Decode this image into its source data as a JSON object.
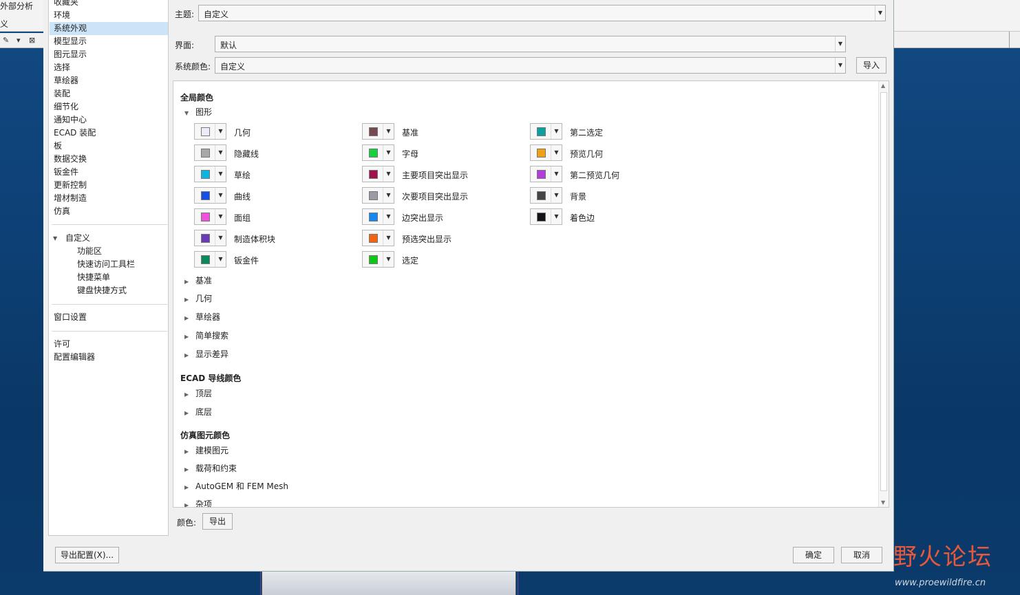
{
  "app": {
    "topbar_line1": "外部分析",
    "topbar_line2": "义"
  },
  "nav": {
    "items": [
      "收藏夹",
      "环境",
      "系统外观",
      "模型显示",
      "图元显示",
      "选择",
      "草绘器",
      "装配",
      "细节化",
      "通知中心",
      "ECAD 装配",
      "板",
      "数据交换",
      "钣金件",
      "更新控制",
      "增材制造",
      "仿真"
    ],
    "selected": "系统外观",
    "customize": "自定义",
    "customize_children": [
      "功能区",
      "快速访问工具栏",
      "快捷菜单",
      "键盘快捷方式"
    ],
    "window_settings": "窗口设置",
    "license": "许可",
    "config_editor": "配置编辑器"
  },
  "form": {
    "theme_label": "主题:",
    "theme_value": "自定义",
    "ui_label": "界面:",
    "ui_value": "默认",
    "syscolor_label": "系统颜色:",
    "syscolor_value": "自定义",
    "import_btn": "导入"
  },
  "panel": {
    "global_colors": "全局颜色",
    "graphics": "图形",
    "collapsed_global": [
      "基准",
      "几何",
      "草绘器",
      "简单搜索",
      "显示差异"
    ],
    "ecad_title": "ECAD 导线颜色",
    "ecad_items": [
      "顶层",
      "底层"
    ],
    "sim_title": "仿真图元颜色",
    "sim_items": [
      "建模图元",
      "载荷和约束",
      "AutoGEM 和 FEM Mesh",
      "杂项"
    ]
  },
  "swatches": {
    "col1": [
      {
        "label": "几何",
        "color": "#ecebf7"
      },
      {
        "label": "隐藏线",
        "color": "#a8a8a8"
      },
      {
        "label": "草绘",
        "color": "#0cb4e0"
      },
      {
        "label": "曲线",
        "color": "#1450e6"
      },
      {
        "label": "面组",
        "color": "#f050dc"
      },
      {
        "label": "制造体积块",
        "color": "#6a3cb4"
      },
      {
        "label": "钣金件",
        "color": "#0a8a5a"
      }
    ],
    "col2": [
      {
        "label": "基准",
        "color": "#784850"
      },
      {
        "label": "字母",
        "color": "#14d23c"
      },
      {
        "label": "主要项目突出显示",
        "color": "#a0104c"
      },
      {
        "label": "次要项目突出显示",
        "color": "#9a9ca4"
      },
      {
        "label": "边突出显示",
        "color": "#1488f0"
      },
      {
        "label": "预选突出显示",
        "color": "#f06414"
      },
      {
        "label": "选定",
        "color": "#0ac814"
      }
    ],
    "col3": [
      {
        "label": "第二选定",
        "color": "#0aa0a0"
      },
      {
        "label": "预览几何",
        "color": "#f0a014"
      },
      {
        "label": "第二预览几何",
        "color": "#b43cdc"
      },
      {
        "label": "背景",
        "color": "#444448"
      },
      {
        "label": "着色边",
        "color": "#141418"
      }
    ]
  },
  "bottom": {
    "color_label": "颜色:",
    "export_btn": "导出",
    "export_config_btn": "导出配置(X)...",
    "ok_btn": "确定",
    "cancel_btn": "取消"
  },
  "watermark": {
    "title": "野火论坛",
    "url": "www.proewildfire.cn"
  }
}
